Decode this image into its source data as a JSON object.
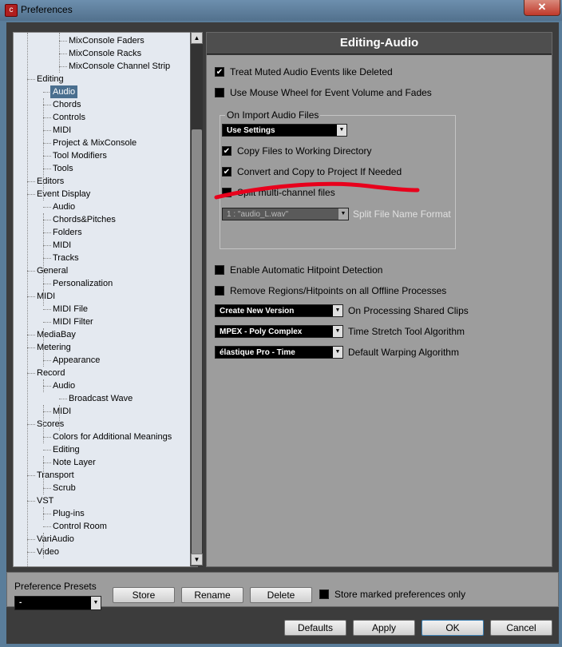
{
  "window": {
    "title": "Preferences",
    "close_label": "✕",
    "app_icon": "cubase-icon"
  },
  "tree": {
    "items": [
      {
        "label": "MixConsole Faders",
        "level": 3
      },
      {
        "label": "MixConsole Racks",
        "level": 3
      },
      {
        "label": "MixConsole Channel Strip",
        "level": 3
      },
      {
        "label": "Editing",
        "level": 1
      },
      {
        "label": "Audio",
        "level": 2,
        "selected": true
      },
      {
        "label": "Chords",
        "level": 2
      },
      {
        "label": "Controls",
        "level": 2
      },
      {
        "label": "MIDI",
        "level": 2
      },
      {
        "label": "Project & MixConsole",
        "level": 2
      },
      {
        "label": "Tool Modifiers",
        "level": 2
      },
      {
        "label": "Tools",
        "level": 2
      },
      {
        "label": "Editors",
        "level": 1
      },
      {
        "label": "Event Display",
        "level": 1
      },
      {
        "label": "Audio",
        "level": 2
      },
      {
        "label": "Chords&Pitches",
        "level": 2
      },
      {
        "label": "Folders",
        "level": 2
      },
      {
        "label": "MIDI",
        "level": 2
      },
      {
        "label": "Tracks",
        "level": 2
      },
      {
        "label": "General",
        "level": 1
      },
      {
        "label": "Personalization",
        "level": 2
      },
      {
        "label": "MIDI",
        "level": 1
      },
      {
        "label": "MIDI File",
        "level": 2
      },
      {
        "label": "MIDI Filter",
        "level": 2
      },
      {
        "label": "MediaBay",
        "level": 1
      },
      {
        "label": "Metering",
        "level": 1
      },
      {
        "label": "Appearance",
        "level": 2
      },
      {
        "label": "Record",
        "level": 1
      },
      {
        "label": "Audio",
        "level": 2
      },
      {
        "label": "Broadcast Wave",
        "level": 3
      },
      {
        "label": "MIDI",
        "level": 2
      },
      {
        "label": "Scores",
        "level": 1
      },
      {
        "label": "Colors for Additional Meanings",
        "level": 2
      },
      {
        "label": "Editing",
        "level": 2
      },
      {
        "label": "Note Layer",
        "level": 2
      },
      {
        "label": "Transport",
        "level": 1
      },
      {
        "label": "Scrub",
        "level": 2
      },
      {
        "label": "VST",
        "level": 1
      },
      {
        "label": "Plug-ins",
        "level": 2
      },
      {
        "label": "Control Room",
        "level": 2
      },
      {
        "label": "VariAudio",
        "level": 1
      },
      {
        "label": "Video",
        "level": 1
      }
    ]
  },
  "panel": {
    "title": "Editing-Audio",
    "treat_muted": {
      "label": "Treat Muted Audio Events like Deleted",
      "checked": true
    },
    "mouse_wheel": {
      "label": "Use Mouse Wheel for Event Volume and Fades",
      "checked": false
    },
    "import_group": {
      "title": "On Import Audio Files",
      "mode": "Use Settings",
      "copy_files": {
        "label": "Copy Files to Working Directory",
        "checked": true
      },
      "convert_copy": {
        "label": "Convert and Copy to Project If Needed",
        "checked": true
      },
      "split_multichannel": {
        "label": "Split multi-channel files",
        "checked": false
      },
      "split_format_value": "1 : \"audio_L.wav\"",
      "split_format_label": "Split File Name Format"
    },
    "hitpoint": {
      "label": "Enable Automatic Hitpoint Detection",
      "checked": false
    },
    "remove_regions": {
      "label": "Remove Regions/Hitpoints on all Offline Processes",
      "checked": false
    },
    "shared_clips": {
      "value": "Create New Version",
      "label": "On Processing Shared Clips"
    },
    "time_stretch": {
      "value": "MPEX - Poly Complex",
      "label": "Time Stretch Tool Algorithm"
    },
    "warping": {
      "value": "élastique Pro - Time",
      "label": "Default Warping Algorithm"
    }
  },
  "presets": {
    "label": "Preference Presets",
    "value": "-",
    "store": "Store",
    "rename": "Rename",
    "delete": "Delete",
    "store_marked": {
      "label": "Store marked preferences only",
      "checked": false
    }
  },
  "footer": {
    "defaults": "Defaults",
    "apply": "Apply",
    "ok": "OK",
    "cancel": "Cancel"
  },
  "colors": {
    "annotation": "#e8001c",
    "selection": "#4a6f8f",
    "panel_bg": "#9d9d9d"
  }
}
